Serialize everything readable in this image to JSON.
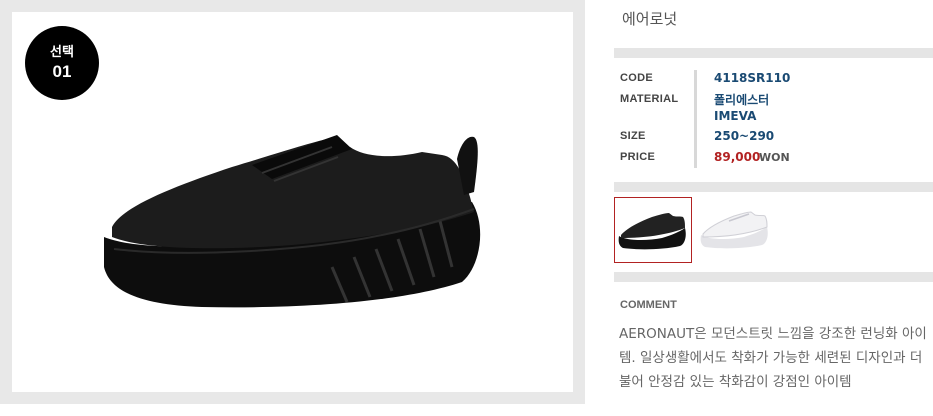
{
  "badge": {
    "line1": "선택",
    "line2": "01"
  },
  "product": {
    "title": "에어로넛",
    "specs": {
      "code_label": "CODE",
      "code_value": "4118SR110",
      "material_label": "MATERIAL",
      "material_value_1": "폴리에스터",
      "material_value_2": "IMEVA",
      "size_label": "SIZE",
      "size_value": "250~290",
      "price_label": "PRICE",
      "price_value": "89,000",
      "currency": "WON"
    }
  },
  "colors": {
    "price": "#b22222",
    "spec_value": "#1a4a73",
    "selected_border": "#b22222"
  },
  "thumbnails": [
    {
      "name": "black-shoe",
      "selected": true
    },
    {
      "name": "white-shoe",
      "selected": false
    }
  ],
  "comment": {
    "label": "COMMENT",
    "text": "AERONAUT은 모던스트릿 느낌을 강조한 런닝화 아이템. 일상생활에서도 착화가 가능한 세련된 디자인과 더불어 안정감 있는 착화감이 강점인 아이템"
  }
}
